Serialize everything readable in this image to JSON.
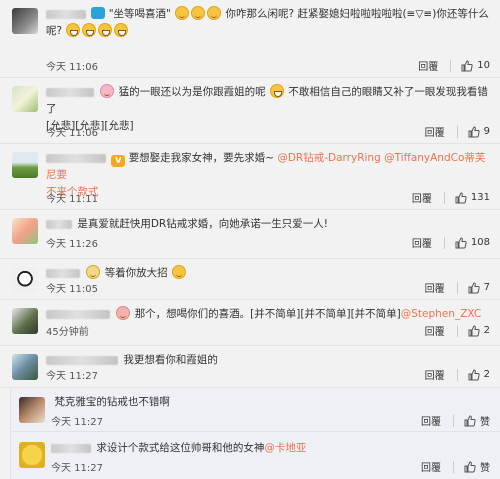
{
  "actions": {
    "reply_label": "回覆"
  },
  "comments": [
    {
      "quote": "\"坐等喝喜酒\"",
      "text1": "你咋那么闲呢?  赶紧娶媳妇啦啦啦啦啦(≡▽≡)你还等什么",
      "text2": "呢?",
      "time": "今天 11:06",
      "likes": "10"
    },
    {
      "text": "猛的一眼还以为是你跟霞姐的呢",
      "text_b": "不敢相信自己的眼睛又补了一眼发现我看错了",
      "text2": "[允悲][允悲][允悲]",
      "time": "今天 11:06",
      "likes": "9"
    },
    {
      "text": "要想娶走我家女神，要先求婚~",
      "mention1": "@DR钻戒-DarryRing",
      "mention2": "@TiffanyAndCo蒂芙尼要",
      "mention3": "不来个款式",
      "time": "今天 11:11",
      "likes": "131"
    },
    {
      "text": "是真爱就赶快用DR钻戒求婚，向她承诺一生只爱一人!",
      "time": "今天 11:26",
      "likes": "108"
    },
    {
      "text": "等着你放大招",
      "time": "今天 11:05",
      "likes": "7"
    },
    {
      "text": "那个，想喝你们的喜酒。[并不简单][并不简单][并不简单]",
      "mention": "@Stephen_ZXC",
      "time": "45分钟前",
      "likes": "2"
    },
    {
      "text": "我更想看你和霞姐的",
      "time": "今天 11:27",
      "likes": "2"
    },
    {
      "text": "梵克雅宝的钻戒也不错啊",
      "time": "今天 11:27",
      "likes": "赞"
    },
    {
      "text": "求设计个款式给这位帅哥和他的女神",
      "mention": "@卡地亚",
      "time": "今天 11:27",
      "likes": "赞"
    }
  ],
  "colors": {
    "link": "#eb7350",
    "background": "#f2f2f2",
    "sub_background": "#eef0f5"
  },
  "icons": [
    "avatar",
    "emoji-face-icon",
    "laugh-emoji-icon",
    "thumbs-up-icon",
    "vip-badge-icon"
  ]
}
